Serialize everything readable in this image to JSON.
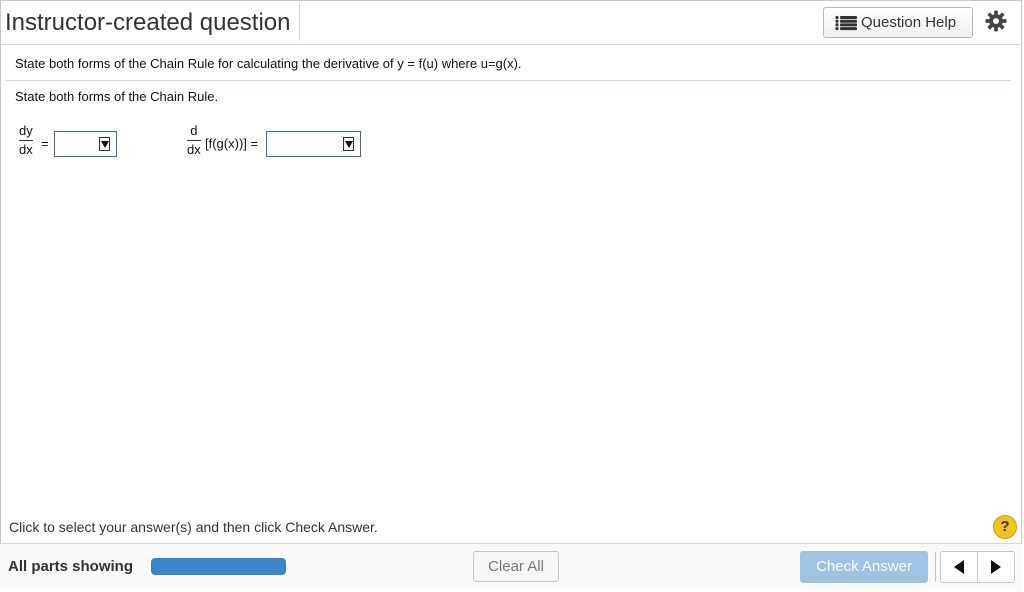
{
  "header": {
    "title": "Instructor-created question",
    "help_label": "Question Help"
  },
  "question": {
    "statement": "State both forms of the Chain Rule for calculating the derivative of y = f(u) where u=g(x).",
    "prompt": "State both forms of the Chain Rule.",
    "form1": {
      "numerator": "dy",
      "denominator": "dx",
      "equals": "="
    },
    "form2": {
      "numerator": "d",
      "denominator": "dx",
      "expression": "[f(g(x))] ="
    }
  },
  "footer": {
    "instruction": "Click to select your answer(s) and then click Check Answer.",
    "help_symbol": "?",
    "parts_label": "All parts showing",
    "progress": 1.0,
    "clear_label": "Clear All",
    "check_label": "Check Answer"
  },
  "colors": {
    "accent_blue": "#3d85c9",
    "check_disabled": "#9fc3e5",
    "help_yellow": "#f3c31c"
  },
  "icons": {
    "help_button": "list-icon",
    "settings": "gear-icon",
    "previous": "triangle-left-icon",
    "next": "triangle-right-icon"
  }
}
